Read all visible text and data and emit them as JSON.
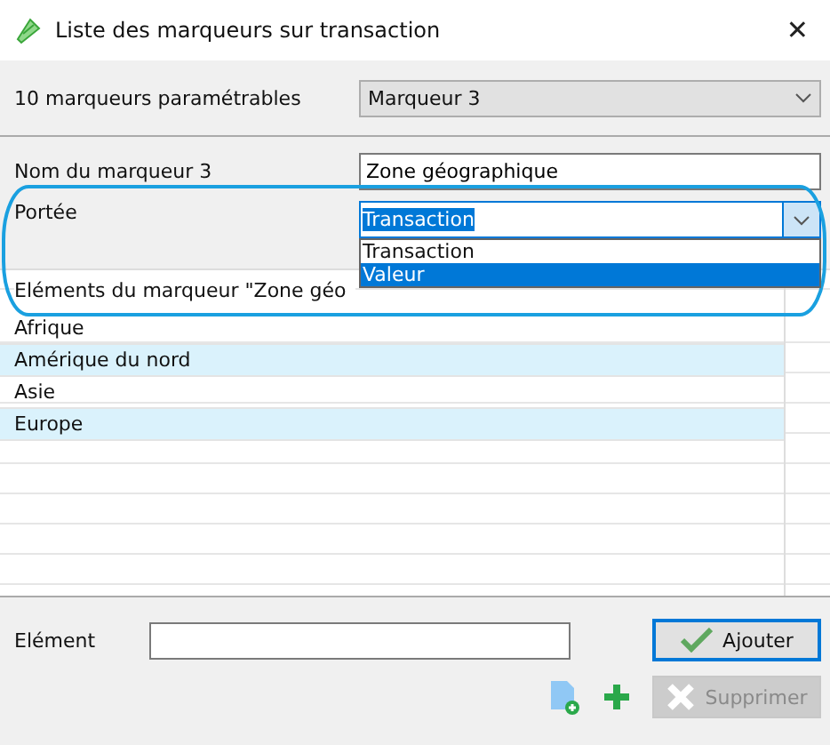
{
  "window": {
    "title": "Liste des marqueurs sur transaction",
    "close": "✕"
  },
  "marker_count": {
    "label": "10 marqueurs paramétrables",
    "value": "Marqueur 3"
  },
  "marker_name": {
    "label": "Nom du marqueur 3",
    "value": "Zone géographique"
  },
  "scope": {
    "label": "Portée",
    "value": "Transaction",
    "expanded": true,
    "options": [
      {
        "label": "Transaction",
        "highlighted": false
      },
      {
        "label": "Valeur",
        "highlighted": true
      }
    ]
  },
  "elements": {
    "header": "Eléments du marqueur \"Zone géo",
    "rows": [
      "Afrique",
      "Amérique du nord",
      "Asie",
      "Europe"
    ]
  },
  "element_field": {
    "label": "Elément"
  },
  "buttons": [
    {
      "label": "Ajouter",
      "kind": "confirm",
      "disabled": false
    },
    {
      "label": "Supprimer",
      "kind": "delete",
      "disabled": true
    }
  ]
}
